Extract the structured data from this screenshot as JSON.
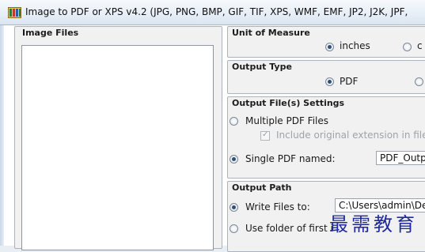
{
  "window": {
    "title": "Image to PDF or XPS  v4.2  (JPG, PNG, BMP, GIF, TIF, XPS, WMF, EMF, JP2, J2K, JPF,"
  },
  "image_files": {
    "title": "Image Files"
  },
  "unit_of_measure": {
    "title": "Unit of Measure",
    "options": [
      "inches",
      "c"
    ],
    "selected": "inches"
  },
  "output_type": {
    "title": "Output Type",
    "options": [
      "PDF",
      ""
    ],
    "selected": "PDF"
  },
  "output_files": {
    "title": "Output File(s) Settings",
    "multiple_label": "Multiple PDF Files",
    "include_ext_label": "Include original extension in file n",
    "include_ext_checked": true,
    "single_label": "Single PDF named:",
    "single_value": "PDF_Outp",
    "selected": "single"
  },
  "output_path": {
    "title": "Output Path",
    "write_label": "Write Files to:",
    "write_value": "C:\\Users\\admin\\De",
    "first_folder_label": "Use folder of first i",
    "selected": "write"
  },
  "watermark": {
    "text": "最需教育"
  }
}
